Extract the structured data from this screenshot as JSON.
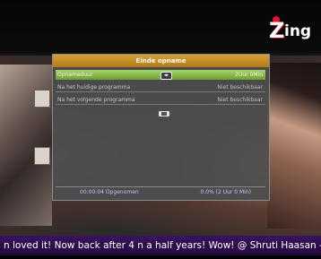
{
  "channel": {
    "logo_text": "Zing"
  },
  "dialog": {
    "title": "Einde opname",
    "rows": [
      {
        "label": "Opnameduur",
        "value": "2Uur 0Min",
        "selected": true
      },
      {
        "label": "Na het huidige programma",
        "value": "Niet beschikbaar",
        "selected": false
      },
      {
        "label": "Na het volgende programma",
        "value": "Niet beschikbaar",
        "selected": false
      }
    ],
    "footer": {
      "recorded": "00:00:04 Opgenomen",
      "progress": "0.0%  (2 Uur 0 Min)"
    }
  },
  "ticker": {
    "text": "n loved it! Now back after 4 n a half years! Wow! @ Shruti Haasan - A"
  }
}
